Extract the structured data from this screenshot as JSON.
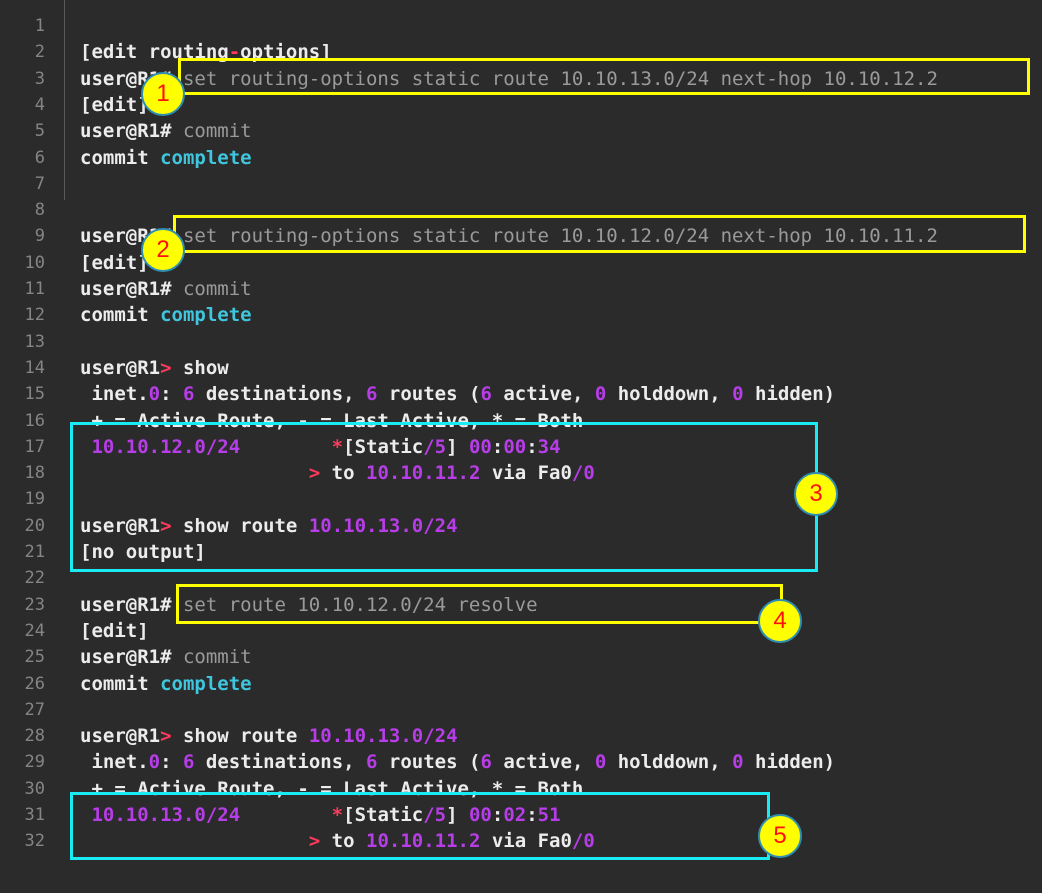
{
  "lines": [
    {
      "n": "1",
      "segs": []
    },
    {
      "n": "2",
      "segs": [
        {
          "t": "[edit routing",
          "c": ""
        },
        {
          "t": "-",
          "c": "op"
        },
        {
          "t": "options]",
          "c": ""
        }
      ]
    },
    {
      "n": "3",
      "segs": [
        {
          "t": "user@R1# ",
          "c": ""
        },
        {
          "t": "set routing-options static route 10.10.13.0/24 next-hop 10.10.12.2",
          "c": "cmd"
        }
      ]
    },
    {
      "n": "4",
      "segs": [
        {
          "t": "[edit]",
          "c": ""
        }
      ]
    },
    {
      "n": "5",
      "segs": [
        {
          "t": "user@R1# ",
          "c": ""
        },
        {
          "t": "commit",
          "c": "cmd"
        }
      ]
    },
    {
      "n": "6",
      "segs": [
        {
          "t": "commit ",
          "c": ""
        },
        {
          "t": "complete",
          "c": "kw"
        }
      ]
    },
    {
      "n": "7",
      "segs": []
    },
    {
      "n": "8",
      "segs": []
    },
    {
      "n": "9",
      "segs": [
        {
          "t": "user@R1# ",
          "c": ""
        },
        {
          "t": "set routing-options static route 10.10.12.0/24 next-hop 10.10.11.2",
          "c": "cmd"
        }
      ]
    },
    {
      "n": "10",
      "segs": [
        {
          "t": "[edit]",
          "c": ""
        }
      ]
    },
    {
      "n": "11",
      "segs": [
        {
          "t": "user@R1# ",
          "c": ""
        },
        {
          "t": "commit",
          "c": "cmd"
        }
      ]
    },
    {
      "n": "12",
      "segs": [
        {
          "t": "commit ",
          "c": ""
        },
        {
          "t": "complete",
          "c": "kw"
        }
      ]
    },
    {
      "n": "13",
      "segs": []
    },
    {
      "n": "14",
      "segs": [
        {
          "t": "user@R1",
          "c": ""
        },
        {
          "t": ">",
          "c": "op"
        },
        {
          "t": " show",
          "c": ""
        }
      ]
    },
    {
      "n": "15",
      "segs": [
        {
          "t": " inet.",
          "c": ""
        },
        {
          "t": "0",
          "c": "num"
        },
        {
          "t": ": ",
          "c": ""
        },
        {
          "t": "6",
          "c": "num"
        },
        {
          "t": " destinations, ",
          "c": ""
        },
        {
          "t": "6",
          "c": "num"
        },
        {
          "t": " routes (",
          "c": ""
        },
        {
          "t": "6",
          "c": "num"
        },
        {
          "t": " active, ",
          "c": ""
        },
        {
          "t": "0",
          "c": "num"
        },
        {
          "t": " holddown, ",
          "c": ""
        },
        {
          "t": "0",
          "c": "num"
        },
        {
          "t": " hidden)",
          "c": ""
        }
      ]
    },
    {
      "n": "16",
      "segs": [
        {
          "t": " + = Active Route, - = Last Active, * = Both",
          "c": ""
        }
      ]
    },
    {
      "n": "17",
      "segs": [
        {
          "t": " 10.10.12.0/24",
          "c": "ip"
        },
        {
          "t": "        ",
          "c": ""
        },
        {
          "t": "*",
          "c": "op"
        },
        {
          "t": "[Static",
          "c": ""
        },
        {
          "t": "/5",
          "c": "num"
        },
        {
          "t": "] ",
          "c": ""
        },
        {
          "t": "00",
          "c": "num"
        },
        {
          "t": ":",
          "c": ""
        },
        {
          "t": "00",
          "c": "num"
        },
        {
          "t": ":",
          "c": ""
        },
        {
          "t": "34",
          "c": "num"
        }
      ]
    },
    {
      "n": "18",
      "segs": [
        {
          "t": "                    ",
          "c": ""
        },
        {
          "t": ">",
          "c": "op"
        },
        {
          "t": " to ",
          "c": ""
        },
        {
          "t": "10.10.11.2",
          "c": "ip"
        },
        {
          "t": " via Fa0",
          "c": ""
        },
        {
          "t": "/0",
          "c": "num"
        }
      ]
    },
    {
      "n": "19",
      "segs": []
    },
    {
      "n": "20",
      "segs": [
        {
          "t": "user@R1",
          "c": ""
        },
        {
          "t": ">",
          "c": "op"
        },
        {
          "t": " show route ",
          "c": ""
        },
        {
          "t": "10.10.13.0/24",
          "c": "ip"
        }
      ]
    },
    {
      "n": "21",
      "segs": [
        {
          "t": "[no output]",
          "c": ""
        }
      ]
    },
    {
      "n": "22",
      "segs": []
    },
    {
      "n": "23",
      "segs": [
        {
          "t": "user@R1# ",
          "c": ""
        },
        {
          "t": "set route 10.10.12.0/24 resolve",
          "c": "cmd"
        }
      ]
    },
    {
      "n": "24",
      "segs": [
        {
          "t": "[edit]",
          "c": ""
        }
      ]
    },
    {
      "n": "25",
      "segs": [
        {
          "t": "user@R1# ",
          "c": ""
        },
        {
          "t": "commit",
          "c": "cmd"
        }
      ]
    },
    {
      "n": "26",
      "segs": [
        {
          "t": "commit ",
          "c": ""
        },
        {
          "t": "complete",
          "c": "kw"
        }
      ]
    },
    {
      "n": "27",
      "segs": []
    },
    {
      "n": "28",
      "segs": [
        {
          "t": "user@R1",
          "c": ""
        },
        {
          "t": ">",
          "c": "op"
        },
        {
          "t": " show route ",
          "c": ""
        },
        {
          "t": "10.10.13.0/24",
          "c": "ip"
        }
      ]
    },
    {
      "n": "29",
      "segs": [
        {
          "t": " inet.",
          "c": ""
        },
        {
          "t": "0",
          "c": "num"
        },
        {
          "t": ": ",
          "c": ""
        },
        {
          "t": "6",
          "c": "num"
        },
        {
          "t": " destinations, ",
          "c": ""
        },
        {
          "t": "6",
          "c": "num"
        },
        {
          "t": " routes (",
          "c": ""
        },
        {
          "t": "6",
          "c": "num"
        },
        {
          "t": " active, ",
          "c": ""
        },
        {
          "t": "0",
          "c": "num"
        },
        {
          "t": " holddown, ",
          "c": ""
        },
        {
          "t": "0",
          "c": "num"
        },
        {
          "t": " hidden)",
          "c": ""
        }
      ]
    },
    {
      "n": "30",
      "segs": [
        {
          "t": " + = Active Route, - = Last Active, * = Both",
          "c": ""
        }
      ]
    },
    {
      "n": "31",
      "segs": [
        {
          "t": " 10.10.13.0/24",
          "c": "ip"
        },
        {
          "t": "        ",
          "c": ""
        },
        {
          "t": "*",
          "c": "op"
        },
        {
          "t": "[Static",
          "c": ""
        },
        {
          "t": "/5",
          "c": "num"
        },
        {
          "t": "] ",
          "c": ""
        },
        {
          "t": "00",
          "c": "num"
        },
        {
          "t": ":",
          "c": ""
        },
        {
          "t": "02",
          "c": "num"
        },
        {
          "t": ":",
          "c": ""
        },
        {
          "t": "51",
          "c": "num"
        }
      ]
    },
    {
      "n": "32",
      "segs": [
        {
          "t": "                    ",
          "c": ""
        },
        {
          "t": ">",
          "c": "op"
        },
        {
          "t": " to ",
          "c": ""
        },
        {
          "t": "10.10.11.2",
          "c": "ip"
        },
        {
          "t": " via Fa0",
          "c": ""
        },
        {
          "t": "/0",
          "c": "num"
        }
      ]
    }
  ],
  "callouts": {
    "c1": "1",
    "c2": "2",
    "c3": "3",
    "c4": "4",
    "c5": "5"
  },
  "colors": {
    "background": "#2b2b2b",
    "text": "#ececec",
    "command": "#9a9a9a",
    "keyword": "#3fc6de",
    "number": "#b73de8",
    "operator": "#ff3a5a",
    "yellow_box": "#ffff00",
    "cyan_box": "#19eaf3",
    "badge_fill": "#ffff00",
    "badge_text": "#ff1111"
  }
}
